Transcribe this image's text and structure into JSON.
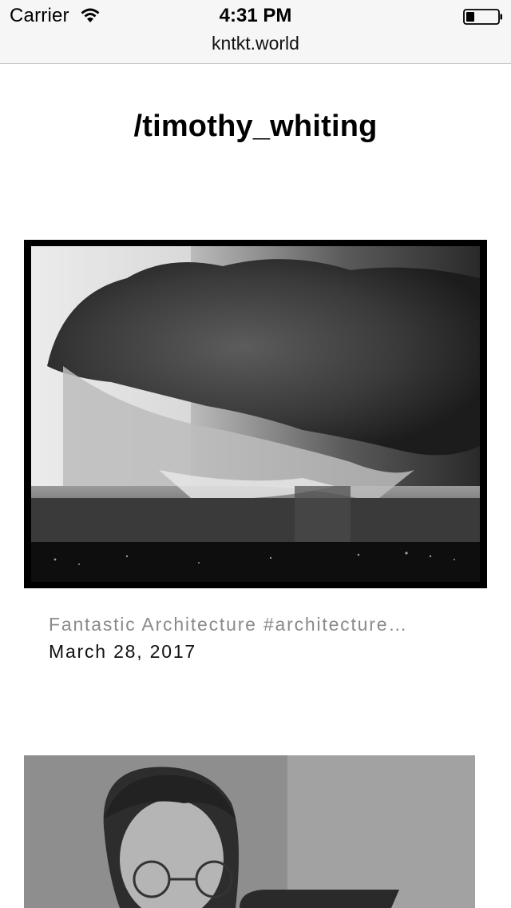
{
  "status_bar": {
    "carrier": "Carrier",
    "time": "4:31 PM",
    "url": "kntkt.world"
  },
  "page": {
    "title": "/timothy_whiting"
  },
  "posts": [
    {
      "caption": "Fantastic Architecture #architecture…",
      "date": "March 28, 2017"
    }
  ]
}
